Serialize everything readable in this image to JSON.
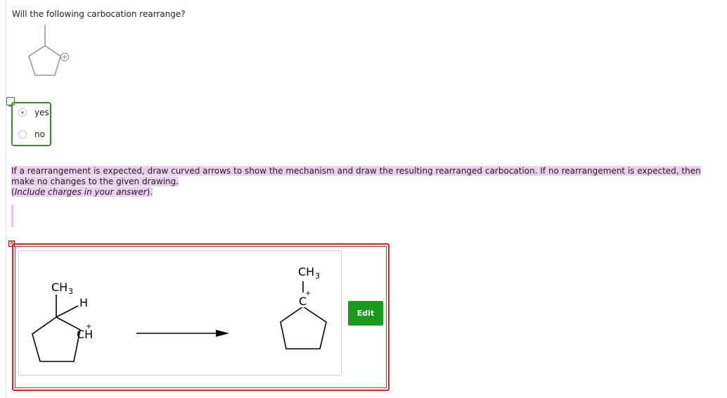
{
  "question": {
    "text": "Will the following carbocation rearrange?"
  },
  "choices": [
    {
      "label": "yes",
      "selected": true
    },
    {
      "label": "no",
      "selected": false
    }
  ],
  "instructions": {
    "line1": "If a rearrangement is expected, draw curved arrows to show the mechanism and draw the resulting rearranged carbocation. If no rearrangement is expected, then",
    "line2": "make no changes to the given drawing.",
    "line3_open": "(",
    "line3_italic": "Include charges in your answer",
    "line3_close": ")."
  },
  "drawing": {
    "left": {
      "methyl_label": "CH",
      "methyl_sub": "3",
      "h_label": "H",
      "ch_label": "CH",
      "charge": "+"
    },
    "right": {
      "methyl_label": "CH",
      "methyl_sub": "3",
      "carbon_label": "C",
      "charge": "+"
    }
  },
  "edit_button": {
    "label": "Edit"
  },
  "colors": {
    "correct": "#3a8a2c",
    "incorrect": "#dd2222",
    "edit_button": "#1a9a1a",
    "highlight": "#ead0ea"
  }
}
